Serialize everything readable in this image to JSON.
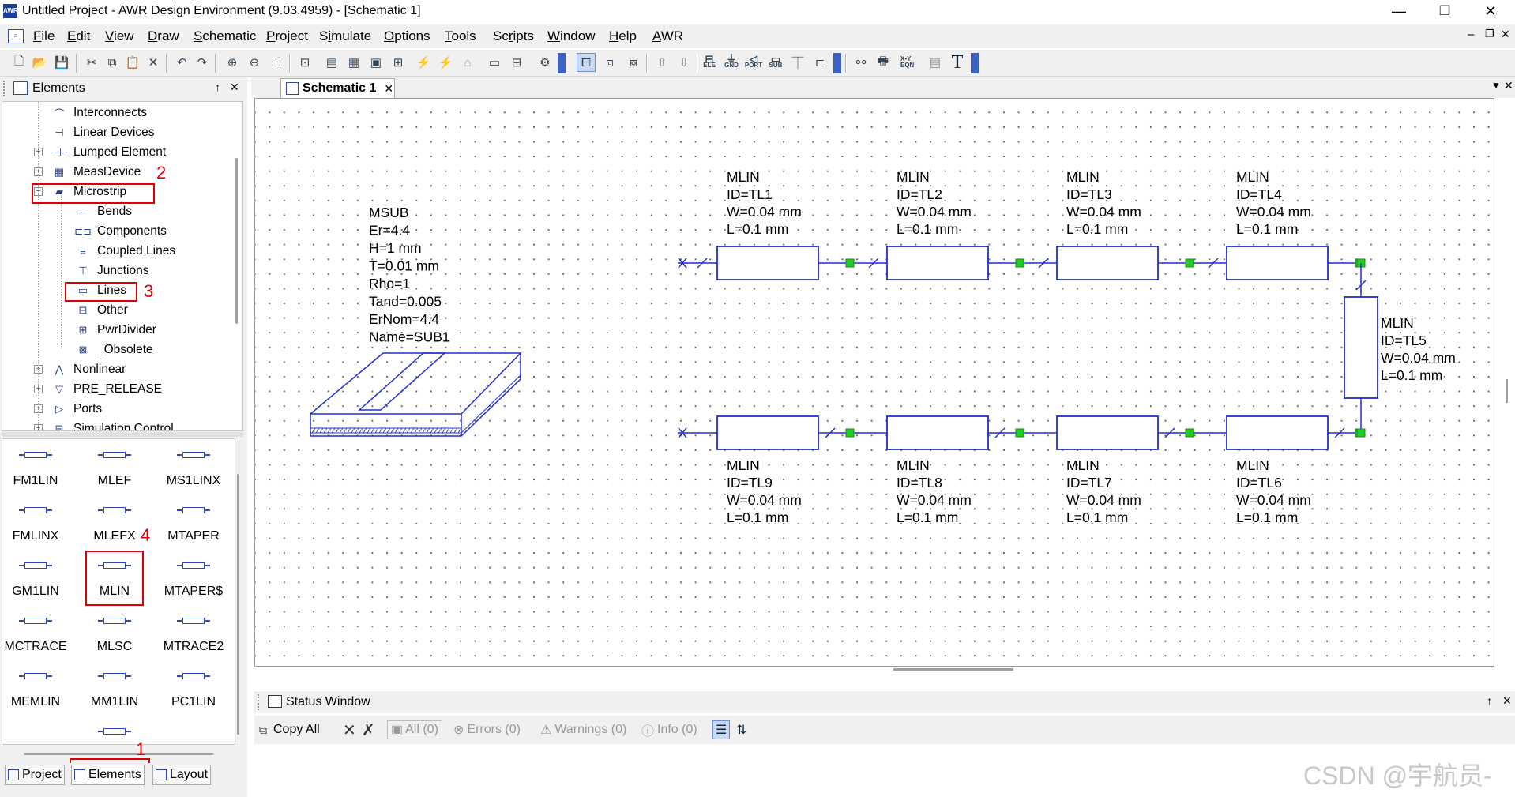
{
  "window": {
    "title": "Untitled Project - AWR Design Environment (9.03.4959) - [Schematic 1]",
    "app_icon": "AWR",
    "minimize": "—",
    "restore": "❐",
    "close": "✕"
  },
  "menu": {
    "items": [
      {
        "prefix": "",
        "ul": "F",
        "rest": "ile"
      },
      {
        "prefix": "",
        "ul": "E",
        "rest": "dit"
      },
      {
        "prefix": "",
        "ul": "V",
        "rest": "iew"
      },
      {
        "prefix": "",
        "ul": "D",
        "rest": "raw"
      },
      {
        "prefix": "",
        "ul": "S",
        "rest": "chematic"
      },
      {
        "prefix": "",
        "ul": "P",
        "rest": "roject"
      },
      {
        "prefix": "S",
        "ul": "i",
        "rest": "mulate"
      },
      {
        "prefix": "",
        "ul": "O",
        "rest": "ptions"
      },
      {
        "prefix": "",
        "ul": "T",
        "rest": "ools"
      },
      {
        "prefix": "Sc",
        "ul": "r",
        "rest": "ipts"
      },
      {
        "prefix": "",
        "ul": "W",
        "rest": "indow"
      },
      {
        "prefix": "",
        "ul": "H",
        "rest": "elp"
      },
      {
        "prefix": "",
        "ul": "A",
        "rest": "WR"
      }
    ],
    "doc_controls": [
      "–",
      "❐",
      "✕"
    ]
  },
  "toolbar": {
    "small_labels": [
      "ELE",
      "GND",
      "PORT",
      "SUB",
      "X•Y EQN"
    ],
    "text_tool": "T"
  },
  "elements_panel": {
    "title": "Elements",
    "pin": "↑",
    "close": "✕",
    "tree": [
      {
        "label": "Interconnects"
      },
      {
        "label": "Linear Devices"
      },
      {
        "label": "Lumped Element"
      },
      {
        "label": "MeasDevice"
      },
      {
        "label": "Microstrip"
      },
      {
        "label": "Bends"
      },
      {
        "label": "Components"
      },
      {
        "label": "Coupled Lines"
      },
      {
        "label": "Junctions"
      },
      {
        "label": "Lines"
      },
      {
        "label": "Other"
      },
      {
        "label": "PwrDivider"
      },
      {
        "label": "_Obsolete"
      },
      {
        "label": "Nonlinear"
      },
      {
        "label": "PRE_RELEASE"
      },
      {
        "label": "Ports"
      },
      {
        "label": "Simulation Control"
      }
    ],
    "palette": [
      "FM1LIN",
      "MLEF",
      "MS1LINX",
      "FMLINX",
      "MLEFX",
      "MTAPER",
      "GM1LIN",
      "MLIN",
      "MTAPER$",
      "MCTRACE",
      "MLSC",
      "MTRACE2",
      "MEMLIN",
      "MM1LIN",
      "PC1LIN"
    ],
    "annotations": [
      "1",
      "2",
      "3",
      "4"
    ],
    "bottom_tabs": [
      "Project",
      "Elements",
      "Layout"
    ]
  },
  "document_tab": {
    "label": "Schematic 1",
    "close": "✕"
  },
  "schematic": {
    "msub": [
      "MSUB",
      "Er=4.4",
      "H=1 mm",
      "T=0.01 mm",
      "Rho=1",
      "Tand=0.005",
      "ErNom=4.4",
      "Name=SUB1"
    ],
    "lines": [
      {
        "type": "MLIN",
        "id": "ID=TL1",
        "w": "W=0.04 mm",
        "l": "L=0.1 mm"
      },
      {
        "type": "MLIN",
        "id": "ID=TL2",
        "w": "W=0.04 mm",
        "l": "L=0.1 mm"
      },
      {
        "type": "MLIN",
        "id": "ID=TL3",
        "w": "W=0.04 mm",
        "l": "L=0.1 mm"
      },
      {
        "type": "MLIN",
        "id": "ID=TL4",
        "w": "W=0.04 mm",
        "l": "L=0.1 mm"
      },
      {
        "type": "MLIN",
        "id": "ID=TL5",
        "w": "W=0.04 mm",
        "l": "L=0.1 mm"
      },
      {
        "type": "MLIN",
        "id": "ID=TL9",
        "w": "W=0.04 mm",
        "l": "L=0.1 mm"
      },
      {
        "type": "MLIN",
        "id": "ID=TL8",
        "w": "W=0.04 mm",
        "l": "L=0.1 mm"
      },
      {
        "type": "MLIN",
        "id": "ID=TL7",
        "w": "W=0.04 mm",
        "l": "L=0.1 mm"
      },
      {
        "type": "MLIN",
        "id": "ID=TL6",
        "w": "W=0.04 mm",
        "l": "L=0.1 mm"
      }
    ]
  },
  "status_window": {
    "title": "Status Window",
    "copy_all": "Copy All",
    "filters": [
      "All (0)",
      "Errors (0)",
      "Warnings (0)",
      "Info (0)"
    ]
  },
  "watermark": "CSDN @宇航员-",
  "colors": {
    "wire": "#1f2fd0",
    "node": "#22cc22",
    "annotation": "#e00000"
  }
}
